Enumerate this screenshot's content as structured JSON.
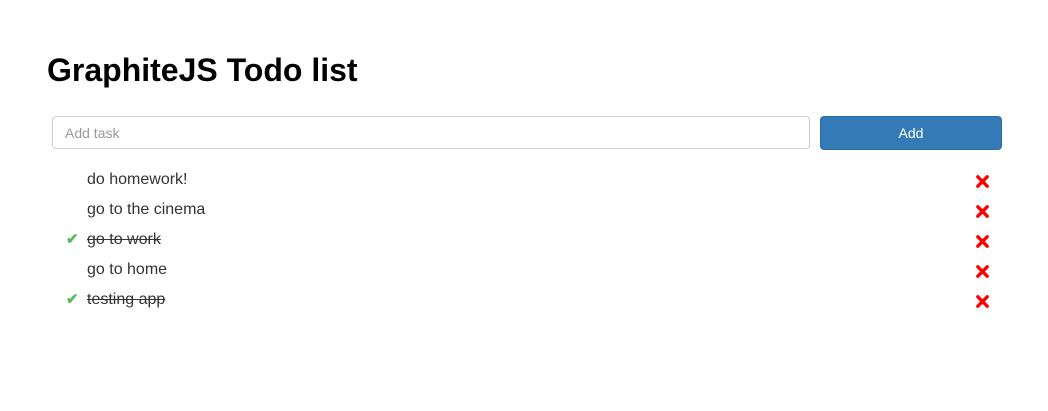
{
  "header": {
    "title": "GraphiteJS Todo list"
  },
  "form": {
    "placeholder": "Add task",
    "value": "",
    "add_label": "Add"
  },
  "colors": {
    "accent": "#337ab7",
    "done_check": "#5cb85c",
    "delete": "#ff0000"
  },
  "tasks": [
    {
      "text": "do homework!",
      "done": false,
      "check_icon": "",
      "delete_icon": "close-icon"
    },
    {
      "text": "go to the cinema",
      "done": false,
      "check_icon": "",
      "delete_icon": "close-icon"
    },
    {
      "text": "go to work",
      "done": true,
      "check_icon": "✔",
      "delete_icon": "close-icon"
    },
    {
      "text": "go to home",
      "done": false,
      "check_icon": "",
      "delete_icon": "close-icon"
    },
    {
      "text": "testing app",
      "done": true,
      "check_icon": "✔",
      "delete_icon": "close-icon"
    }
  ]
}
